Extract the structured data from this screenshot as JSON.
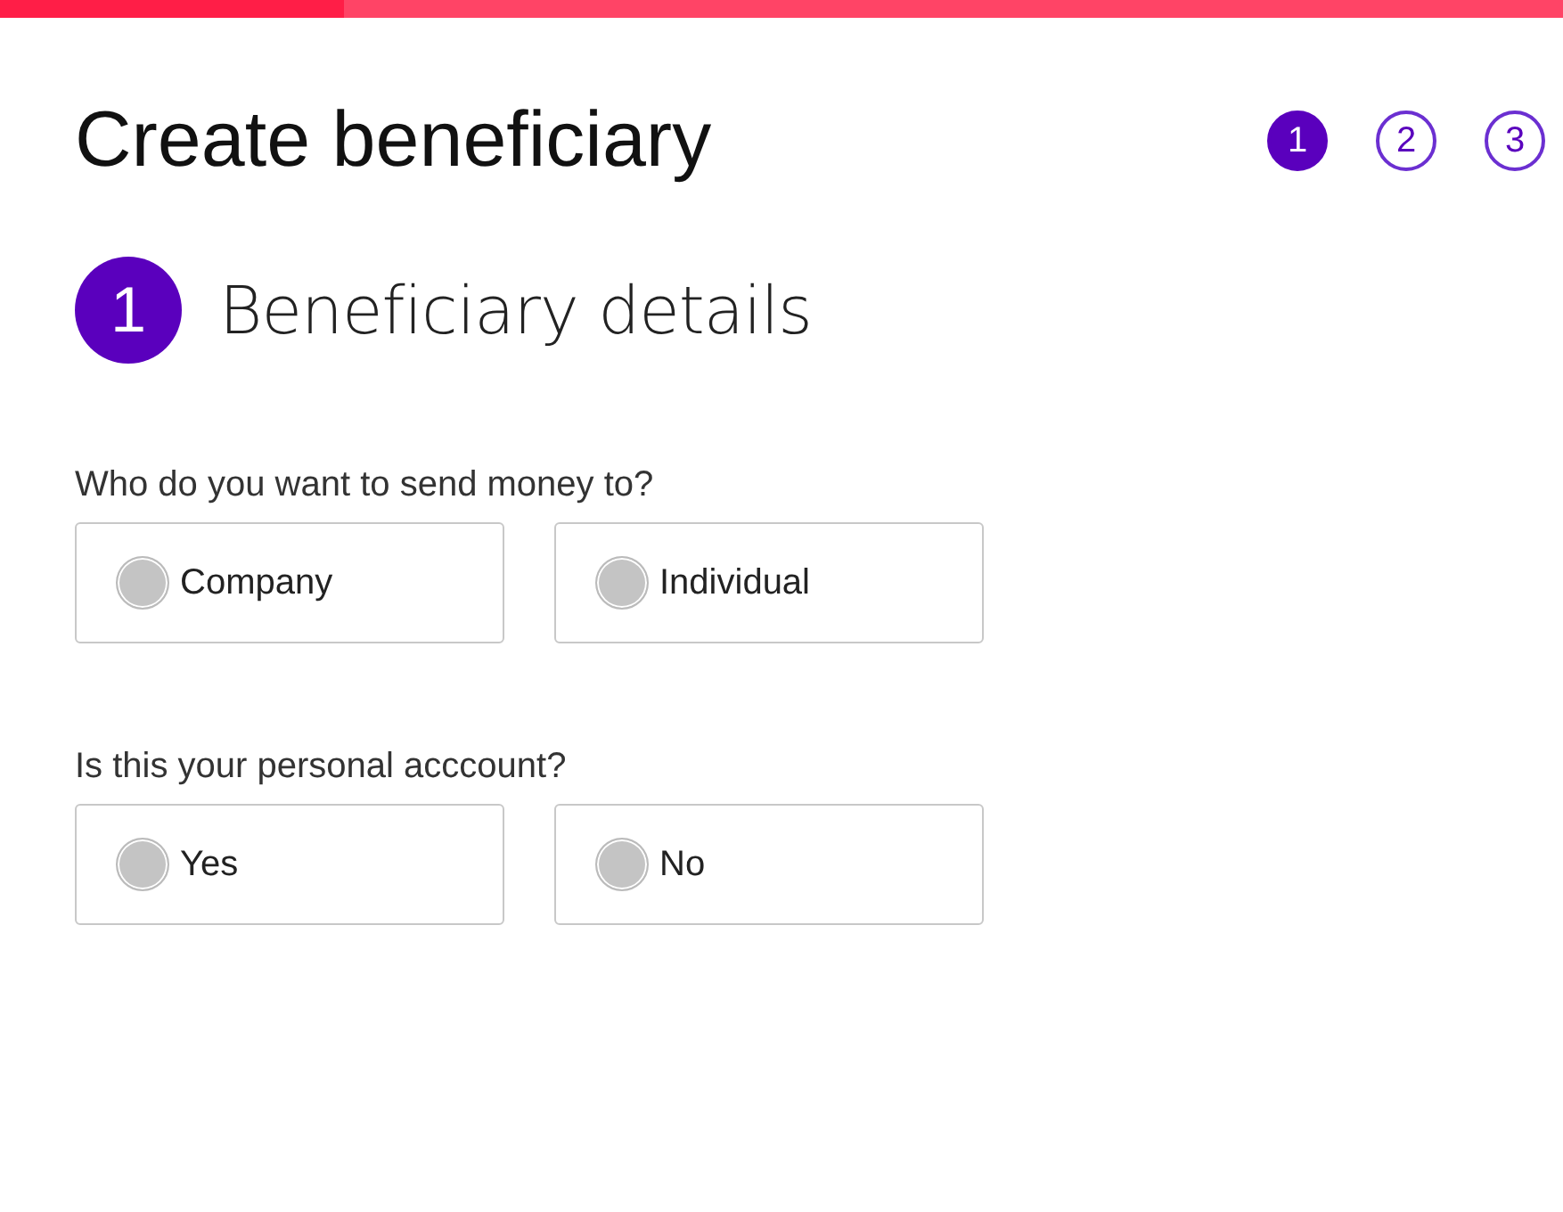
{
  "progress": {
    "level": 0.22
  },
  "title": "Create beneficiary",
  "steps": [
    {
      "label": "1",
      "selected": true
    },
    {
      "label": "2",
      "selected": false
    },
    {
      "label": "3",
      "selected": false
    }
  ],
  "section": {
    "number": "1",
    "title": "Beneficiary details"
  },
  "questions": [
    {
      "label": "Who do you want to send money to?",
      "options": [
        {
          "label": "Company",
          "selected": false
        },
        {
          "label": "Individual",
          "selected": false
        }
      ]
    },
    {
      "label": "Is this your personal acccount?",
      "options": [
        {
          "label": "Yes",
          "selected": false
        },
        {
          "label": "No",
          "selected": false
        }
      ]
    }
  ]
}
